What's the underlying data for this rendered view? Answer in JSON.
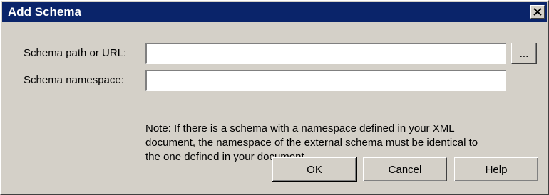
{
  "dialog": {
    "title": "Add Schema",
    "close_glyph": "✕"
  },
  "fields": {
    "schema_path_label": "Schema path or URL:",
    "schema_path_value": "",
    "browse_label": "...",
    "schema_namespace_label": "Schema namespace:",
    "schema_namespace_value": ""
  },
  "note": {
    "text": "Note: If there is a schema with a namespace defined in your XML document, the namespace of the external schema must be identical to the one defined in your document."
  },
  "buttons": {
    "ok": "OK",
    "cancel": "Cancel",
    "help": "Help"
  },
  "colors": {
    "titlebar": "#0a246a",
    "face": "#d4d0c8"
  }
}
